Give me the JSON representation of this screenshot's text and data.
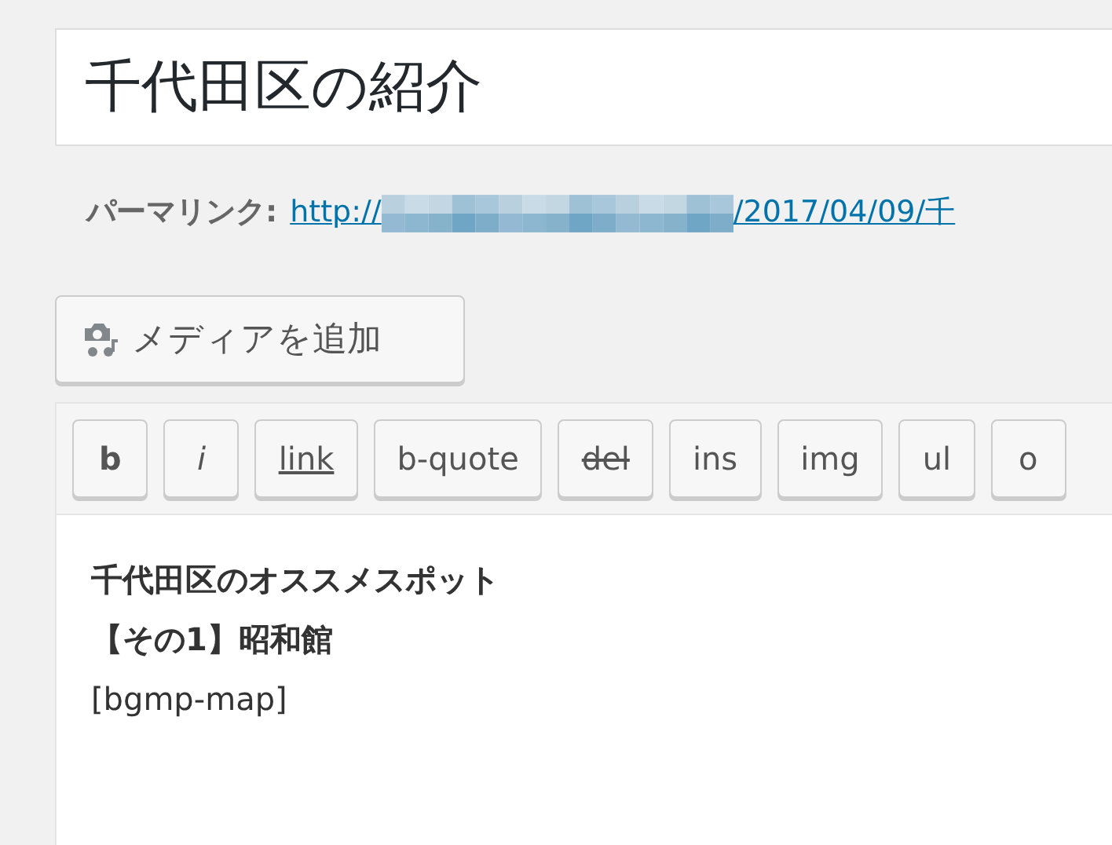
{
  "title_field": {
    "value": "千代田区の紹介"
  },
  "permalink": {
    "label": "パーマリンク:",
    "link_start": "http://",
    "link_end": "/2017/04/09/千"
  },
  "media_button": {
    "label": "メディアを追加"
  },
  "toolbar": [
    {
      "label": "b",
      "kind": "bold"
    },
    {
      "label": "i",
      "kind": "italic"
    },
    {
      "label": "link",
      "kind": "underline"
    },
    {
      "label": "b-quote",
      "kind": "plain"
    },
    {
      "label": "del",
      "kind": "strike"
    },
    {
      "label": "ins",
      "kind": "plain"
    },
    {
      "label": "img",
      "kind": "plain"
    },
    {
      "label": "ul",
      "kind": "plain"
    },
    {
      "label": "o",
      "kind": "plain"
    }
  ],
  "editor": {
    "lines": [
      {
        "text": "千代田区のオススメスポット",
        "bold": true
      },
      {
        "text": "【その1】昭和館",
        "bold": true
      },
      {
        "text": "[bgmp-map]",
        "bold": false
      }
    ]
  }
}
